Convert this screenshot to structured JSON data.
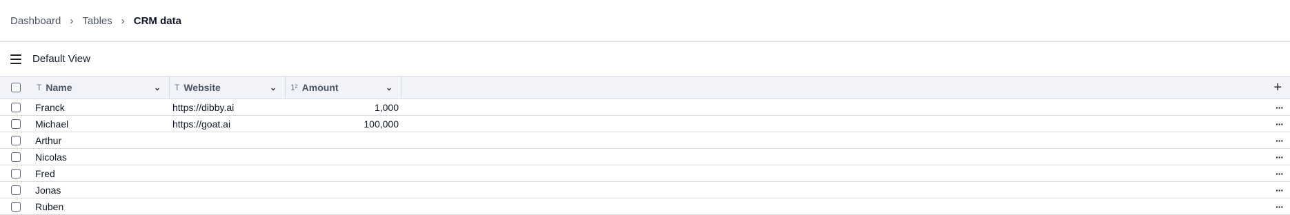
{
  "breadcrumb": {
    "items": [
      "Dashboard",
      "Tables"
    ],
    "current": "CRM data"
  },
  "view": {
    "title": "Default View"
  },
  "table": {
    "columns": [
      {
        "label": "Name",
        "type_icon": "text-type-icon"
      },
      {
        "label": "Website",
        "type_icon": "text-type-icon"
      },
      {
        "label": "Amount",
        "type_icon": "number-type-icon"
      }
    ],
    "rows": [
      {
        "name": "Franck",
        "website": "https://dibby.ai",
        "amount": "1,000"
      },
      {
        "name": "Michael",
        "website": "https://goat.ai",
        "amount": "100,000"
      },
      {
        "name": "Arthur",
        "website": "",
        "amount": ""
      },
      {
        "name": "Nicolas",
        "website": "",
        "amount": ""
      },
      {
        "name": "Fred",
        "website": "",
        "amount": ""
      },
      {
        "name": "Jonas",
        "website": "",
        "amount": ""
      },
      {
        "name": "Ruben",
        "website": "",
        "amount": ""
      }
    ]
  },
  "icons": {
    "text_type": "T",
    "number_type": "1²",
    "chevron": "⌄",
    "add": "+",
    "more": "···",
    "breadcrumb_sep": "›"
  }
}
